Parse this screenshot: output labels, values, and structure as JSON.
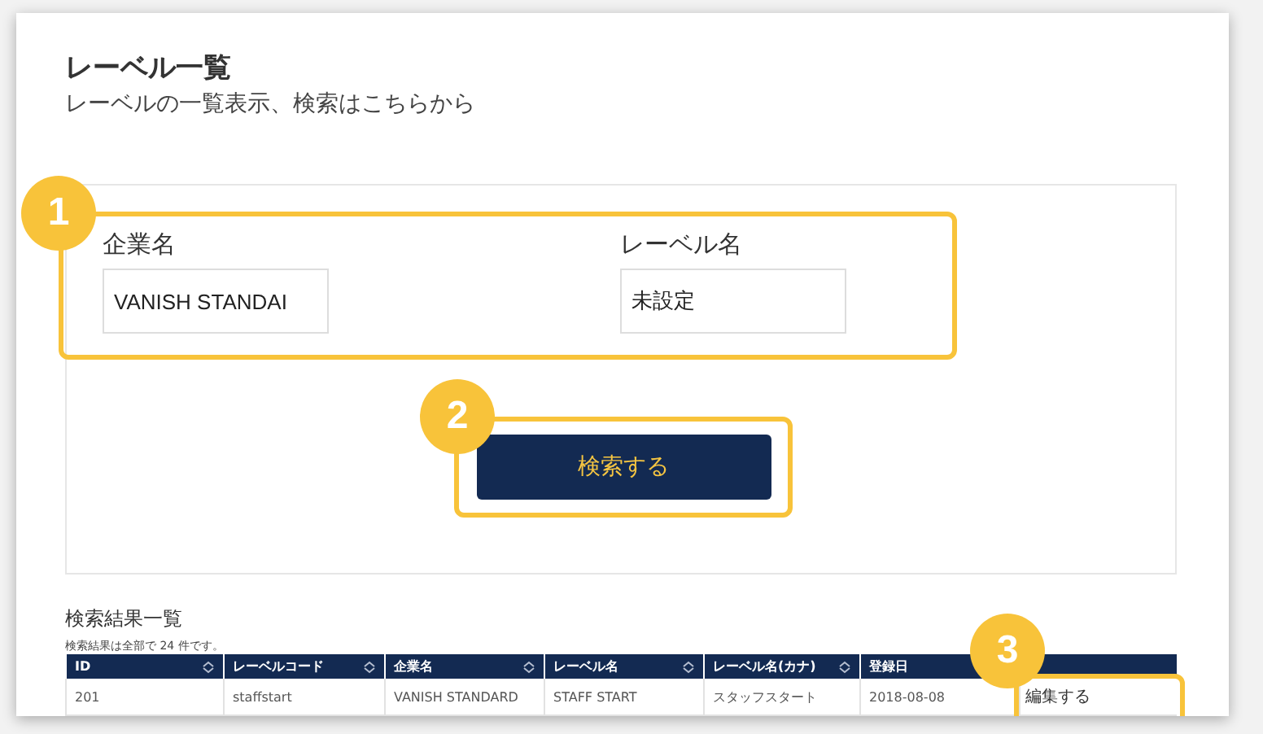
{
  "page": {
    "title": "レーベル一覧",
    "subtitle": "レーベルの一覧表示、検索はこちらから"
  },
  "search_form": {
    "badge": "1",
    "fields": [
      {
        "label": "企業名",
        "value": "VANISH STANDAI"
      },
      {
        "label": "レーベル名",
        "value": "未設定"
      }
    ],
    "button": {
      "label": "検索する",
      "badge": "2"
    }
  },
  "results": {
    "title": "検索結果一覧",
    "count_text": "検索結果は全部で 24 件です。",
    "columns": [
      {
        "label": "ID",
        "sortable": true
      },
      {
        "label": "レーベルコード",
        "sortable": true
      },
      {
        "label": "企業名",
        "sortable": true
      },
      {
        "label": "レーベル名",
        "sortable": true
      },
      {
        "label": "レーベル名(カナ)",
        "sortable": true
      },
      {
        "label": "登録日"
      },
      {}
    ],
    "rows": [
      {
        "cells": [
          "201",
          "staffstart",
          "VANISH STANDARD",
          "STAFF START",
          "スタッフスタート",
          "2018-08-08"
        ],
        "action": "編集する"
      }
    ],
    "action_badge": "3"
  }
}
